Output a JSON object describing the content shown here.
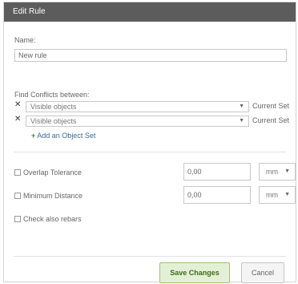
{
  "dialog": {
    "title": "Edit Rule"
  },
  "name_field": {
    "label": "Name:",
    "value": "New rule"
  },
  "conflicts": {
    "label": "Find Conflicts between:",
    "sets": [
      {
        "value": "Visible objects",
        "suffix": "Current Set"
      },
      {
        "value": "Visible objects",
        "suffix": "Current Set"
      }
    ],
    "add_label": "Add an Object Set"
  },
  "overlap": {
    "label": "Overlap Tolerance",
    "value": "0,00",
    "unit": "mm",
    "checked": false
  },
  "min_distance": {
    "label": "Minimum Distance",
    "value": "0,00",
    "unit": "mm",
    "checked": false
  },
  "rebars": {
    "label": "Check also rebars",
    "checked": false
  },
  "buttons": {
    "save": "Save Changes",
    "cancel": "Cancel"
  },
  "colors": {
    "titlebar": "#5c5c5c",
    "save_bg": "#e4f0d6",
    "save_text": "#3f6b1e"
  },
  "icons": {
    "remove": "close-icon",
    "add": "plus-icon",
    "dropdown": "chevron-down-icon"
  }
}
